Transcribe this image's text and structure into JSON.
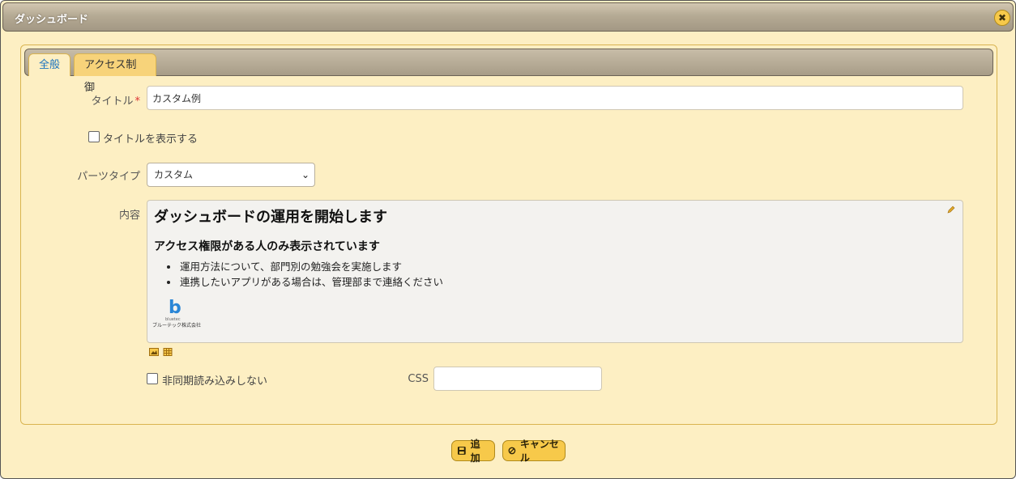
{
  "dialog": {
    "title": "ダッシュボード",
    "close_icon": "close-icon"
  },
  "tabs": [
    {
      "label": "全般",
      "active": true
    },
    {
      "label": "アクセス制御",
      "active": false
    }
  ],
  "form": {
    "title_label": "タイトル",
    "title_required": "*",
    "title_value": "カスタム例",
    "show_title_label": "タイトルを表示する",
    "show_title_checked": false,
    "parts_type_label": "パーツタイプ",
    "parts_type_value": "カスタム",
    "content_label": "内容",
    "content": {
      "heading1": "ダッシュボードの運用を開始します",
      "heading2": "アクセス権限がある人のみ表示されています",
      "bullets": [
        "運用方法について、部門別の勉強会を実施します",
        "連携したいアプリがある場合は、管理部まで連絡ください"
      ],
      "logo_letter": "b",
      "logo_sub": "bluetec",
      "logo_company": "ブルーテック株式会社"
    },
    "no_async_label": "非同期読み込みしない",
    "no_async_checked": false,
    "css_label": "CSS",
    "css_value": ""
  },
  "actions": {
    "add_label": "追加",
    "cancel_label": "キャンセル"
  },
  "colors": {
    "accent": "#f7c94a",
    "panel_bg": "#fdefc3",
    "tab_active_text": "#1c74c0",
    "required": "#dd3333"
  }
}
